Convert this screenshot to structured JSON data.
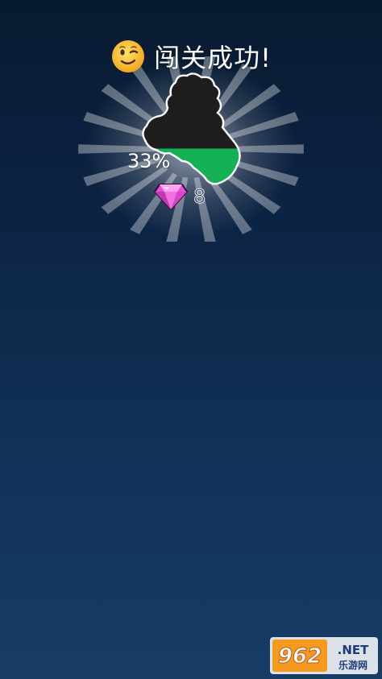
{
  "header": {
    "emoji_icon": "winking-face-emoji",
    "title": "闯关成功!"
  },
  "result": {
    "fill_percent_label": "33%",
    "fill_fraction": 0.33,
    "island_colors": {
      "unfilled": "#1e1e1e",
      "filled": "#14b155",
      "outline": "#ffffff"
    }
  },
  "reward": {
    "icon": "pink-gem-icon",
    "count": "8",
    "gem_color": "#e84fd6"
  },
  "watermark": {
    "brand_number": "962",
    "brand_suffix": ".NET",
    "brand_chinese": "乐游网"
  }
}
